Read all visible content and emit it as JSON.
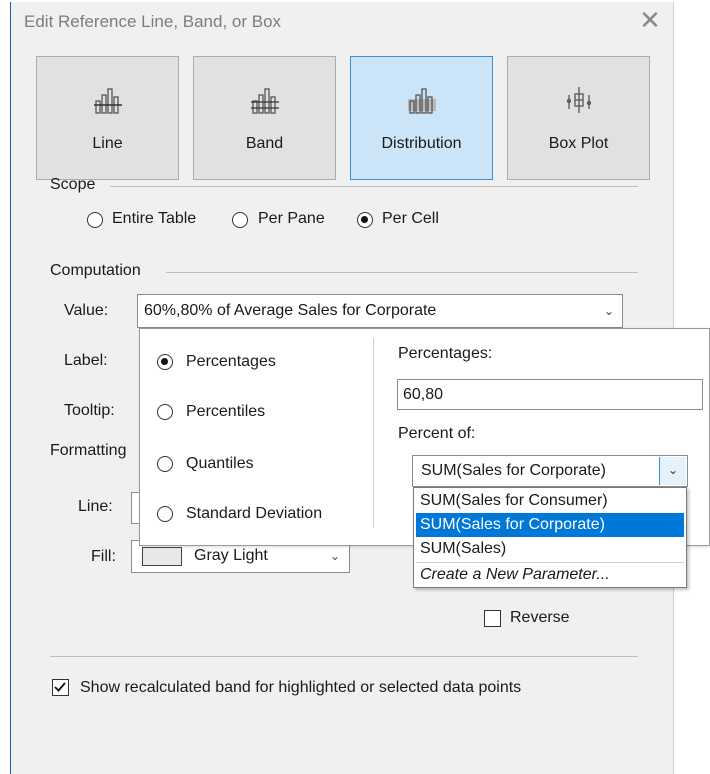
{
  "dialog": {
    "title": "Edit Reference Line, Band, or Box",
    "close_glyph": "✕"
  },
  "type_buttons": [
    {
      "label": "Line",
      "selected": false
    },
    {
      "label": "Band",
      "selected": false
    },
    {
      "label": "Distribution",
      "selected": true
    },
    {
      "label": "Box Plot",
      "selected": false
    }
  ],
  "scope": {
    "label": "Scope",
    "options": [
      {
        "label": "Entire Table",
        "selected": false
      },
      {
        "label": "Per Pane",
        "selected": false
      },
      {
        "label": "Per Cell",
        "selected": true
      }
    ]
  },
  "computation": {
    "label": "Computation",
    "value_label": "Value:",
    "value": "60%,80% of Average Sales for Corporate",
    "label_label": "Label:",
    "tooltip_label": "Tooltip:"
  },
  "formatting": {
    "label": "Formatting",
    "line_label": "Line:",
    "fill_label": "Fill:",
    "fill_value": "Gray Light",
    "reverse_label": "Reverse",
    "reverse_checked": false
  },
  "popup": {
    "options": [
      {
        "label": "Percentages",
        "selected": true
      },
      {
        "label": "Percentiles",
        "selected": false
      },
      {
        "label": "Quantiles",
        "selected": false
      },
      {
        "label": "Standard Deviation",
        "selected": false
      }
    ],
    "percentages_label": "Percentages:",
    "percentages_value": "60,80",
    "percent_of_label": "Percent of:",
    "percent_of_value": "SUM(Sales for Corporate)",
    "dropdown_items": [
      {
        "label": "SUM(Sales for Consumer)",
        "highlighted": false
      },
      {
        "label": "SUM(Sales for Corporate)",
        "highlighted": true
      },
      {
        "label": "SUM(Sales)",
        "highlighted": false
      },
      {
        "label": "Create a New Parameter...",
        "highlighted": false,
        "italic": true
      }
    ]
  },
  "footer": {
    "show_recalc_label": "Show recalculated band for highlighted or selected data points",
    "show_recalc_checked": true
  },
  "colors": {
    "accent": "#0078d7",
    "selected_button": "#cce4f7",
    "dialog_bg": "#f0f0f0"
  }
}
